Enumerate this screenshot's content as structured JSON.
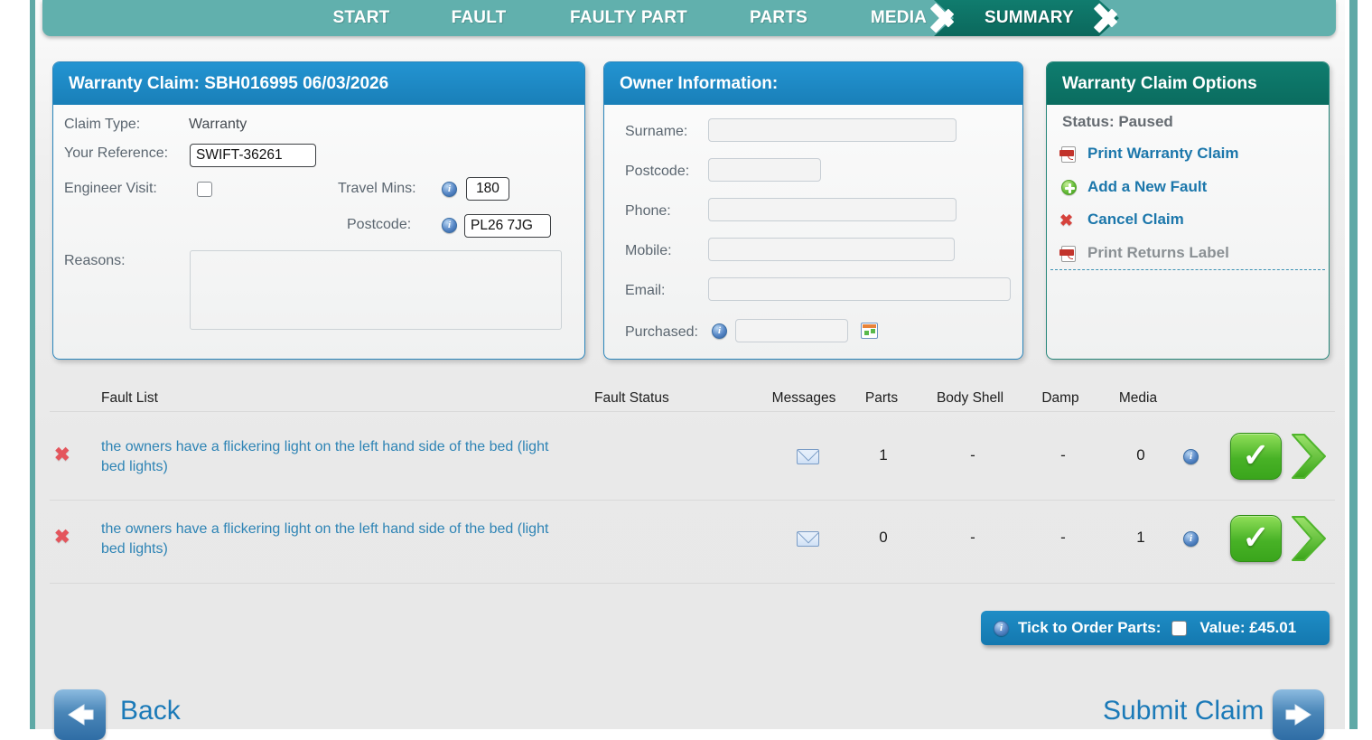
{
  "nav": {
    "steps": [
      "START",
      "FAULT",
      "FAULTY PART",
      "PARTS",
      "MEDIA",
      "SUMMARY"
    ],
    "active_step": "SUMMARY"
  },
  "claim_panel": {
    "title": "Warranty Claim: SBH016995 06/03/2026",
    "claim_type_label": "Claim Type:",
    "claim_type_value": "Warranty",
    "your_reference_label": "Your Reference:",
    "your_reference_value": "SWIFT-36261",
    "engineer_visit_label": "Engineer Visit:",
    "engineer_visit_checked": false,
    "travel_mins_label": "Travel Mins:",
    "travel_mins_value": "180",
    "postcode_label": "Postcode:",
    "postcode_value": "PL26 7JG",
    "reasons_label": "Reasons:",
    "reasons_value": ""
  },
  "owner_panel": {
    "title": "Owner Information:",
    "surname_label": "Surname:",
    "surname_value": "",
    "postcode_label": "Postcode:",
    "postcode_value": "",
    "phone_label": "Phone:",
    "phone_value": "",
    "mobile_label": "Mobile:",
    "mobile_value": "",
    "email_label": "Email:",
    "email_value": "",
    "purchased_label": "Purchased:",
    "purchased_value": ""
  },
  "options_panel": {
    "title": "Warranty Claim Options",
    "status_text": "Status: Paused",
    "print_claim_label": "Print Warranty Claim",
    "add_fault_label": "Add a New Fault",
    "cancel_claim_label": "Cancel Claim",
    "print_returns_label": "Print Returns Label"
  },
  "fault_table": {
    "headers": {
      "fault_list": "Fault List",
      "fault_status": "Fault Status",
      "messages": "Messages",
      "parts": "Parts",
      "body_shell": "Body Shell",
      "damp": "Damp",
      "media": "Media"
    },
    "rows": [
      {
        "fault": "the owners have a flickering light on the left hand side of the bed (light bed lights)",
        "fault_status": "",
        "parts": "1",
        "body_shell": "-",
        "damp": "-",
        "media": "0"
      },
      {
        "fault": "the owners have a flickering light on the left hand side of the bed (light bed lights)",
        "fault_status": "",
        "parts": "0",
        "body_shell": "-",
        "damp": "-",
        "media": "1"
      }
    ]
  },
  "order_bar": {
    "label": "Tick to Order Parts:",
    "checked": false,
    "value_text": "Value: £45.01"
  },
  "footer": {
    "back_label": "Back",
    "submit_label": "Submit Claim"
  },
  "colors": {
    "nav_teal": "#61b0ad",
    "active_step_green": "#0d7263",
    "panel_header_blue": "#1e88c5",
    "options_header_teal": "#0c7468",
    "link_blue": "#1c77ab",
    "fault_text_blue": "#2e84b5",
    "order_bar_blue": "#1a83bb"
  }
}
